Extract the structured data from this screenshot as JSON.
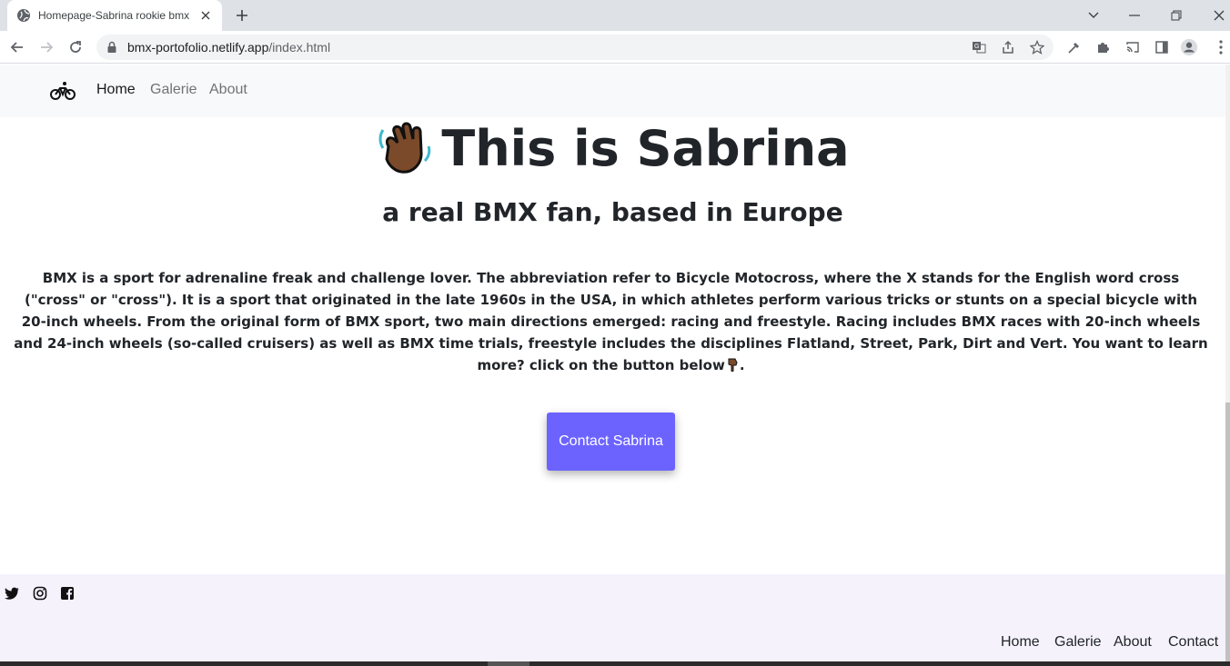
{
  "browser": {
    "tab_title": "Homepage-Sabrina rookie bmx r",
    "url_host": "bmx-portofolio.netlify.app",
    "url_path": "/index.html"
  },
  "nav": {
    "links": [
      "Home",
      "Galerie",
      "About"
    ]
  },
  "hero": {
    "title": "This is Sabrina",
    "subtitle": "a real BMX fan, based in Europe"
  },
  "intro": {
    "text": "BMX is a sport for adrenaline freak and challenge lover. The abbreviation refer to Bicycle Motocross, where the X stands for the English word cross (\"cross\" or \"cross\"). It is a sport that originated in the late 1960s in the USA, in which athletes perform various tricks or stunts on a special bicycle with 20-inch wheels. From the original form of BMX sport, two main directions emerged: racing and freestyle. Racing includes BMX races with 20-inch wheels and 24-inch wheels (so-called cruisers) as well as BMX time trials, freestyle includes the disciplines Flatland, Street, Park, Dirt and Vert. You want to learn more? click on the button below",
    "tail": "."
  },
  "cta": {
    "label": "Contact Sabrina",
    "color": "#6c63ff"
  },
  "footer": {
    "social": [
      "twitter-icon",
      "instagram-icon",
      "facebook-icon"
    ],
    "links": [
      "Home",
      "Galerie",
      "About",
      "Contact"
    ],
    "background": "#f5f2fc"
  }
}
